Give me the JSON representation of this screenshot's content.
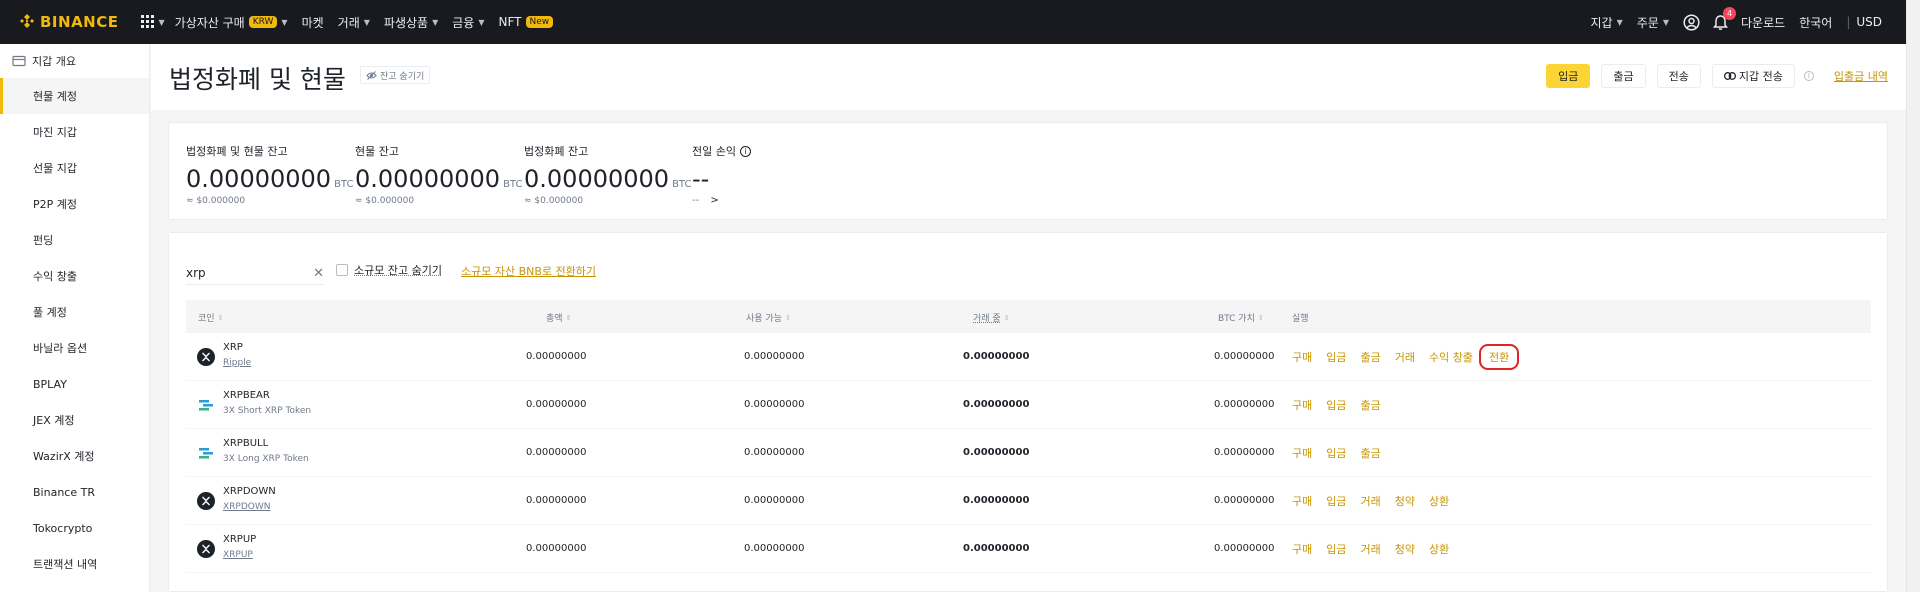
{
  "topnav": {
    "logo": "BINANCE",
    "items": [
      {
        "label": "가상자산 구매",
        "badge": "KRW",
        "caret": true
      },
      {
        "label": "마켓",
        "caret": false
      },
      {
        "label": "거래",
        "caret": true
      },
      {
        "label": "파생상품",
        "caret": true
      },
      {
        "label": "금융",
        "caret": true
      },
      {
        "label": "NFT",
        "badge": "New",
        "caret": false
      }
    ],
    "right": {
      "wallet": "지갑",
      "orders": "주문",
      "notifications": "4",
      "download": "다운로드",
      "language": "한국어",
      "currency": "USD"
    }
  },
  "sidebar": {
    "items": [
      {
        "label": "지갑 개요",
        "active": false,
        "head": true
      },
      {
        "label": "현물 계정",
        "active": true
      },
      {
        "label": "마진 지갑",
        "active": false
      },
      {
        "label": "선물 지갑",
        "active": false
      },
      {
        "label": "P2P 계정",
        "active": false
      },
      {
        "label": "펀딩",
        "active": false
      },
      {
        "label": "수익 창출",
        "active": false
      },
      {
        "label": "풀 계정",
        "active": false
      },
      {
        "label": "바닐라 옵션",
        "active": false
      },
      {
        "label": "BPLAY",
        "active": false
      },
      {
        "label": "JEX 계정",
        "active": false
      },
      {
        "label": "WazirX 계정",
        "active": false
      },
      {
        "label": "Binance TR",
        "active": false
      },
      {
        "label": "Tokocrypto",
        "active": false
      },
      {
        "label": "트랜잭션 내역",
        "active": false
      }
    ]
  },
  "header": {
    "title": "법정화폐 및 현물",
    "hide_balance": "잔고 숨기기",
    "buttons": {
      "deposit": "입금",
      "withdraw": "출금",
      "transfer": "전송",
      "wallet_transfer": "지갑 전송"
    },
    "history_link": "입출금 내역"
  },
  "balances": {
    "total": {
      "label": "법정화폐 및 현물 잔고",
      "value": "0.00000000",
      "unit": "BTC",
      "fiat": "≈ $0.000000"
    },
    "spot": {
      "label": "현물 잔고",
      "value": "0.00000000",
      "unit": "BTC",
      "fiat": "≈ $0.000000"
    },
    "fiat": {
      "label": "법정화폐 잔고",
      "value": "0.00000000",
      "unit": "BTC",
      "fiat": "≈ $0.000000"
    },
    "pnl": {
      "label": "전일 손익",
      "value": "--",
      "sub": "--",
      "arrow": ">"
    }
  },
  "filters": {
    "search_value": "xrp",
    "hide_small": "소규모 잔고 숨기기",
    "convert_link": "소규모 자산 BNB로 전환하기"
  },
  "table": {
    "headers": {
      "coin": "코인",
      "total": "총액",
      "available": "사용 가능",
      "in_order": "거래 중",
      "btc_value": "BTC 가치",
      "action": "실행"
    },
    "rows": [
      {
        "symbol": "XRP",
        "name": "Ripple",
        "total": "0.00000000",
        "available": "0.00000000",
        "in_order": "0.00000000",
        "btc_value": "0.00000000",
        "icon": "xrp-icon",
        "actions": [
          "구매",
          "입금",
          "출금",
          "거래",
          "수익 창출",
          "전환"
        ]
      },
      {
        "symbol": "XRPBEAR",
        "name": "3X Short XRP Token",
        "total": "0.00000000",
        "available": "0.00000000",
        "in_order": "0.00000000",
        "btc_value": "0.00000000",
        "icon": "leveraged-token-icon",
        "actions": [
          "구매",
          "입금",
          "출금"
        ]
      },
      {
        "symbol": "XRPBULL",
        "name": "3X Long XRP Token",
        "total": "0.00000000",
        "available": "0.00000000",
        "in_order": "0.00000000",
        "btc_value": "0.00000000",
        "icon": "leveraged-token-icon",
        "actions": [
          "구매",
          "입금",
          "출금"
        ]
      },
      {
        "symbol": "XRPDOWN",
        "name": "XRPDOWN",
        "total": "0.00000000",
        "available": "0.00000000",
        "in_order": "0.00000000",
        "btc_value": "0.00000000",
        "icon": "xrp-icon",
        "actions": [
          "구매",
          "입금",
          "거래",
          "청약",
          "상환"
        ]
      },
      {
        "symbol": "XRPUP",
        "name": "XRPUP",
        "total": "0.00000000",
        "available": "0.00000000",
        "in_order": "0.00000000",
        "btc_value": "0.00000000",
        "icon": "xrp-icon",
        "actions": [
          "구매",
          "입금",
          "거래",
          "청약",
          "상환"
        ]
      }
    ]
  },
  "colors": {
    "accent": "#f0b90b",
    "link": "#c99400",
    "nav_bg": "#181a20",
    "highlight": "#e02424"
  }
}
